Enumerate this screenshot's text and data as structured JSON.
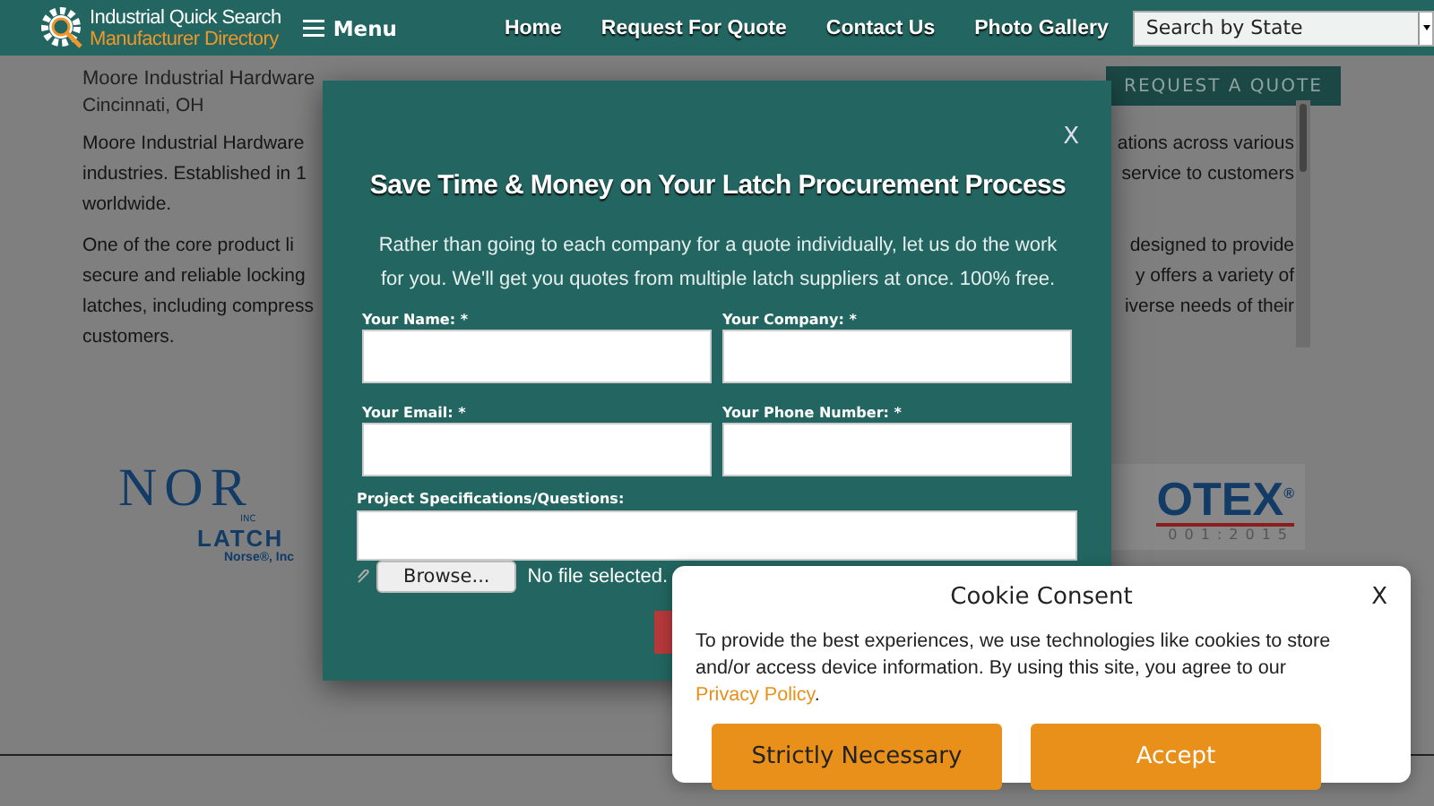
{
  "header": {
    "logo_line_1": "Industrial Quick Search",
    "logo_line_2": "Manufacturer Directory",
    "menu_label": "Menu",
    "nav": [
      "Home",
      "Request For Quote",
      "Contact Us",
      "Photo Gallery"
    ],
    "state_select": {
      "value": "Search by State"
    }
  },
  "company": {
    "name": "Moore Industrial Hardware",
    "location": "Cincinnati, OH",
    "request_button": "REQUEST A QUOTE",
    "paragraphs": [
      [
        {
          "left": "Moore Industrial Hardware",
          "right": "ations across various"
        },
        {
          "left": "industries. Established in 1",
          "right": "service to customers"
        },
        {
          "left": "worldwide."
        }
      ],
      [
        {
          "left": "One of the core product li",
          "right": "designed to provide"
        },
        {
          "left": "secure and reliable locking",
          "right": "y offers a variety of"
        },
        {
          "left": "latches, including compress",
          "right": "iverse needs of their"
        },
        {
          "left": "customers."
        }
      ]
    ]
  },
  "logos": {
    "left": {
      "big": "NOR",
      "inc": "INC",
      "latch": "LATCH",
      "caption": "Norse®, Inc"
    },
    "right": {
      "big": "OTEX",
      "reg": "®",
      "iso": "001:2015"
    }
  },
  "quote_modal": {
    "close": "X",
    "title": "Save Time & Money on Your Latch Procurement Process",
    "description": "Rather than going to each company for a quote individually, let us do the work for you. We'll get you quotes from multiple latch suppliers at once. 100% free.",
    "fields": [
      {
        "label": "Your Name: *"
      },
      {
        "label": "Your Company: *"
      },
      {
        "label": "Your Email: *"
      },
      {
        "label": "Your Phone Number: *"
      }
    ],
    "project_label": "Project Specifications/Questions:",
    "browse_button": "Browse...",
    "file_status": "No file selected."
  },
  "cookie_consent": {
    "title": "Cookie Consent",
    "close": "X",
    "text_before": "To provide the best experiences, we use technologies like cookies to store and/or access device information. By using this site, you agree to our ",
    "link": "Privacy Policy",
    "text_after": ".",
    "buttons": [
      "Strictly Necessary",
      "Accept"
    ]
  }
}
